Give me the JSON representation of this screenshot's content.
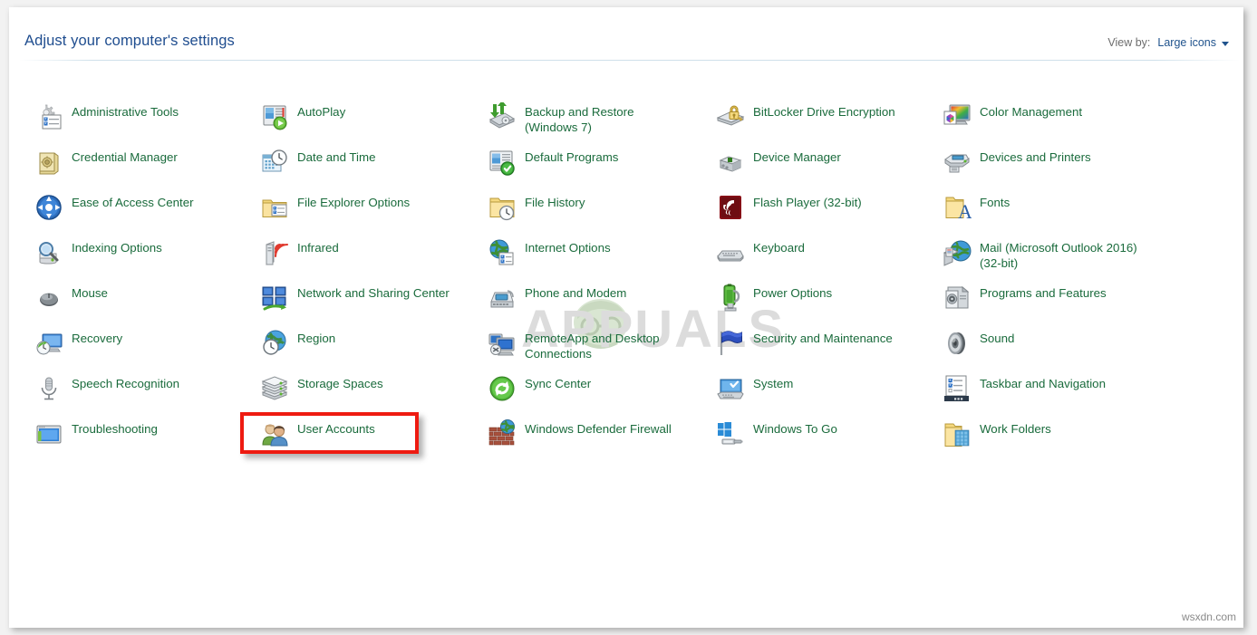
{
  "header": {
    "title": "Adjust your computer's settings",
    "view_by_label": "View by:",
    "view_by_value": "Large icons",
    "view_by_caret_icon": "chevron-down-icon"
  },
  "watermark": {
    "text": "APPUALS"
  },
  "credit": {
    "text": "wsxdn.com"
  },
  "colors": {
    "link_green": "#1a6b3c",
    "title_blue": "#1f4d8f",
    "highlight_red": "#ee1b11",
    "window_bg": "#ffffff",
    "desktop_bg": "#f2f2f2"
  },
  "highlight": {
    "target": "User Accounts",
    "shape": "red-rectangle"
  },
  "items": [
    {
      "label": "Administrative Tools",
      "icon": "administrative-tools-icon",
      "col": 0,
      "row": 0
    },
    {
      "label": "Credential Manager",
      "icon": "credential-manager-icon",
      "col": 0,
      "row": 1
    },
    {
      "label": "Ease of Access Center",
      "icon": "ease-of-access-icon",
      "col": 0,
      "row": 2
    },
    {
      "label": "Indexing Options",
      "icon": "indexing-options-icon",
      "col": 0,
      "row": 3
    },
    {
      "label": "Mouse",
      "icon": "mouse-icon",
      "col": 0,
      "row": 4
    },
    {
      "label": "Recovery",
      "icon": "recovery-icon",
      "col": 0,
      "row": 5
    },
    {
      "label": "Speech Recognition",
      "icon": "speech-recognition-icon",
      "col": 0,
      "row": 6
    },
    {
      "label": "Troubleshooting",
      "icon": "troubleshooting-icon",
      "col": 0,
      "row": 7
    },
    {
      "label": "AutoPlay",
      "icon": "autoplay-icon",
      "col": 1,
      "row": 0
    },
    {
      "label": "Date and Time",
      "icon": "date-and-time-icon",
      "col": 1,
      "row": 1
    },
    {
      "label": "File Explorer Options",
      "icon": "file-explorer-options-icon",
      "col": 1,
      "row": 2
    },
    {
      "label": "Infrared",
      "icon": "infrared-icon",
      "col": 1,
      "row": 3
    },
    {
      "label": "Network and Sharing Center",
      "icon": "network-sharing-icon",
      "col": 1,
      "row": 4
    },
    {
      "label": "Region",
      "icon": "region-icon",
      "col": 1,
      "row": 5
    },
    {
      "label": "Storage Spaces",
      "icon": "storage-spaces-icon",
      "col": 1,
      "row": 6
    },
    {
      "label": "User Accounts",
      "icon": "user-accounts-icon",
      "col": 1,
      "row": 7
    },
    {
      "label": "Backup and Restore (Windows 7)",
      "icon": "backup-restore-icon",
      "col": 2,
      "row": 0
    },
    {
      "label": "Default Programs",
      "icon": "default-programs-icon",
      "col": 2,
      "row": 1
    },
    {
      "label": "File History",
      "icon": "file-history-icon",
      "col": 2,
      "row": 2
    },
    {
      "label": "Internet Options",
      "icon": "internet-options-icon",
      "col": 2,
      "row": 3
    },
    {
      "label": "Phone and Modem",
      "icon": "phone-and-modem-icon",
      "col": 2,
      "row": 4
    },
    {
      "label": "RemoteApp and Desktop Connections",
      "icon": "remoteapp-icon",
      "col": 2,
      "row": 5
    },
    {
      "label": "Sync Center",
      "icon": "sync-center-icon",
      "col": 2,
      "row": 6
    },
    {
      "label": "Windows Defender Firewall",
      "icon": "defender-firewall-icon",
      "col": 2,
      "row": 7
    },
    {
      "label": "BitLocker Drive Encryption",
      "icon": "bitlocker-icon",
      "col": 3,
      "row": 0
    },
    {
      "label": "Device Manager",
      "icon": "device-manager-icon",
      "col": 3,
      "row": 1
    },
    {
      "label": "Flash Player (32-bit)",
      "icon": "flash-player-icon",
      "col": 3,
      "row": 2
    },
    {
      "label": "Keyboard",
      "icon": "keyboard-icon",
      "col": 3,
      "row": 3
    },
    {
      "label": "Power Options",
      "icon": "power-options-icon",
      "col": 3,
      "row": 4
    },
    {
      "label": "Security and Maintenance",
      "icon": "security-maintenance-icon",
      "col": 3,
      "row": 5
    },
    {
      "label": "System",
      "icon": "system-icon",
      "col": 3,
      "row": 6
    },
    {
      "label": "Windows To Go",
      "icon": "windows-to-go-icon",
      "col": 3,
      "row": 7
    },
    {
      "label": "Color Management",
      "icon": "color-management-icon",
      "col": 4,
      "row": 0
    },
    {
      "label": "Devices and Printers",
      "icon": "devices-printers-icon",
      "col": 4,
      "row": 1
    },
    {
      "label": "Fonts",
      "icon": "fonts-icon",
      "col": 4,
      "row": 2
    },
    {
      "label": "Mail (Microsoft Outlook 2016) (32-bit)",
      "icon": "mail-icon",
      "col": 4,
      "row": 3
    },
    {
      "label": "Programs and Features",
      "icon": "programs-features-icon",
      "col": 4,
      "row": 4
    },
    {
      "label": "Sound",
      "icon": "sound-icon",
      "col": 4,
      "row": 5
    },
    {
      "label": "Taskbar and Navigation",
      "icon": "taskbar-navigation-icon",
      "col": 4,
      "row": 6
    },
    {
      "label": "Work Folders",
      "icon": "work-folders-icon",
      "col": 4,
      "row": 7
    }
  ]
}
